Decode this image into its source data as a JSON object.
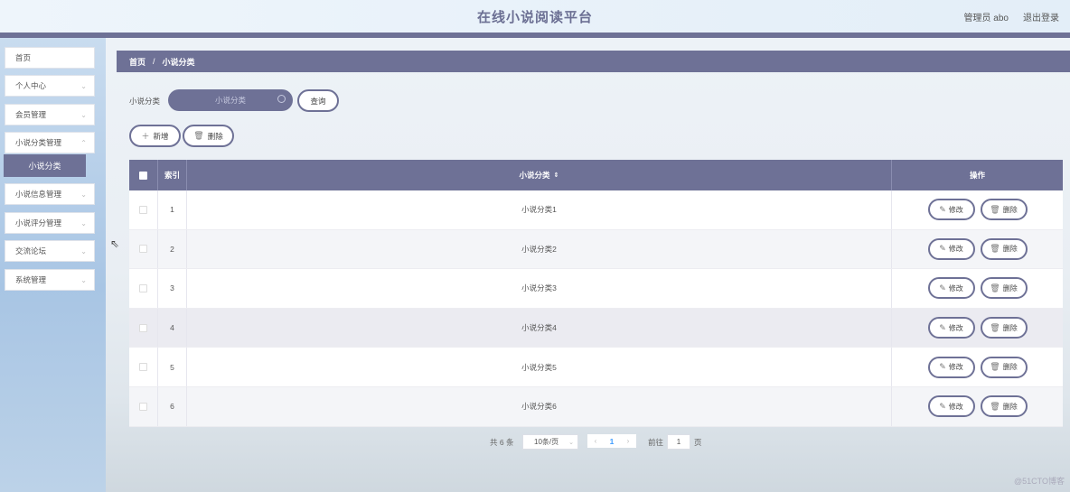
{
  "header": {
    "title": "在线小说阅读平台",
    "user": "管理员 abo",
    "logout": "退出登录"
  },
  "sidebar": {
    "items": [
      {
        "label": "首页",
        "chevron": false
      },
      {
        "label": "个人中心",
        "chevron": true
      },
      {
        "label": "会员管理",
        "chevron": true
      },
      {
        "label": "小说分类管理",
        "chevron": true
      },
      {
        "label": "小说信息管理",
        "chevron": true
      },
      {
        "label": "小说评分管理",
        "chevron": true
      },
      {
        "label": "交流论坛",
        "chevron": true
      },
      {
        "label": "系统管理",
        "chevron": true
      }
    ],
    "active_sub": "小说分类"
  },
  "breadcrumb": {
    "home": "首页",
    "separator": "/",
    "current": "小说分类"
  },
  "search": {
    "label": "小说分类",
    "placeholder": "小说分类",
    "query_button": "查询"
  },
  "actions": {
    "add": "新增",
    "delete": "删除"
  },
  "table": {
    "headers": {
      "index": "索引",
      "name": "小说分类",
      "ops": "操作"
    },
    "rows": [
      {
        "index": "1",
        "name": "小说分类1"
      },
      {
        "index": "2",
        "name": "小说分类2"
      },
      {
        "index": "3",
        "name": "小说分类3"
      },
      {
        "index": "4",
        "name": "小说分类4"
      },
      {
        "index": "5",
        "name": "小说分类5"
      },
      {
        "index": "6",
        "name": "小说分类6"
      }
    ],
    "edit_label": "修改",
    "delete_label": "删除"
  },
  "pagination": {
    "total": "共 6 条",
    "page_size": "10条/页",
    "current_page": "1",
    "goto_label": "前往",
    "goto_value": "1",
    "page_suffix": "页"
  },
  "watermark": "@51CTO博客",
  "colors": {
    "accent": "#6e7196",
    "link": "#409eff"
  }
}
